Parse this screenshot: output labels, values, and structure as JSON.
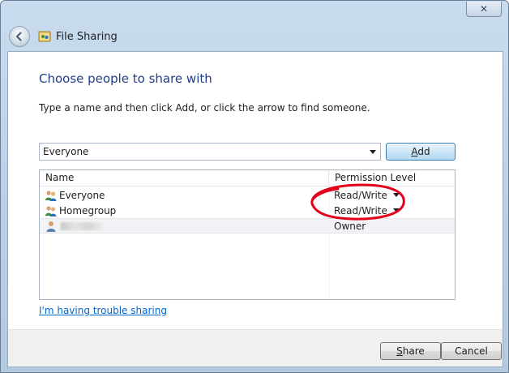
{
  "window": {
    "title": "File Sharing",
    "close_symbol": "✕"
  },
  "heading": "Choose people to share with",
  "instructions": "Type a name and then click Add, or click the arrow to find someone.",
  "name_input": {
    "value": "Everyone"
  },
  "add_button": {
    "label_access_key": "A",
    "label_rest": "dd"
  },
  "list": {
    "columns": [
      "Name",
      "Permission Level"
    ],
    "rows": [
      {
        "name": "Everyone",
        "permission": "Read/Write",
        "icon": "group-icon"
      },
      {
        "name": "Homegroup",
        "permission": "Read/Write",
        "icon": "group-icon"
      },
      {
        "name": "",
        "permission": "Owner",
        "icon": "user-icon"
      }
    ]
  },
  "trouble_link": "I'm having trouble sharing",
  "footer": {
    "share_access_key": "S",
    "share_rest": "hare",
    "cancel_label": "Cancel"
  },
  "colors": {
    "heading": "#1f3d8a",
    "link": "#0066cc",
    "annotation": "#e3001b"
  }
}
